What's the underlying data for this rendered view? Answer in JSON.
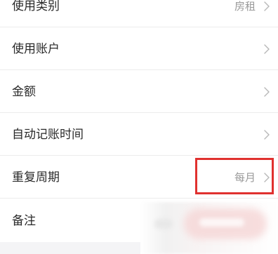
{
  "rows": [
    {
      "label": "使用类别",
      "value": "房租"
    },
    {
      "label": "使用账户",
      "value": ""
    },
    {
      "label": "金额",
      "value": ""
    },
    {
      "label": "自动记账时间",
      "value": ""
    },
    {
      "label": "重复周期",
      "value": "每月"
    },
    {
      "label": "备注",
      "value": ""
    }
  ],
  "colors": {
    "highlight": "#e0312f",
    "divider": "#ececec",
    "value_text": "#9a9a9a"
  },
  "icons": {
    "chevron": "chevron-right-icon"
  }
}
